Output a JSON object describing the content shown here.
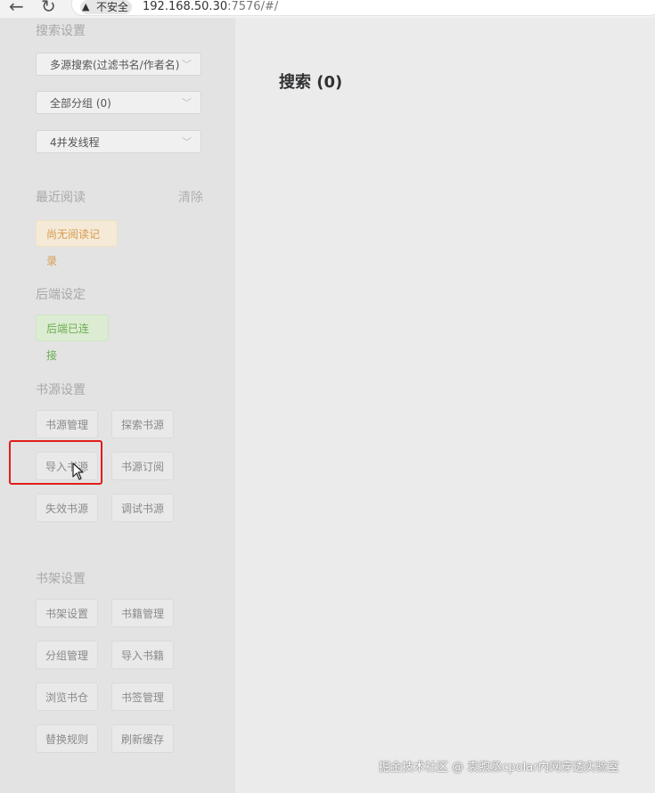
{
  "browser": {
    "security_label": "不安全",
    "url_host": "192.168.50.30",
    "url_rest": ":7576/#/"
  },
  "sidebar": {
    "search_settings": {
      "title": "搜索设置",
      "source_select": "多源搜索(过滤书名/作者名)",
      "group_select": "全部分组 (0)",
      "thread_select": "4并发线程"
    },
    "recent": {
      "title": "最近阅读",
      "clear_label": "清除",
      "empty_label": "尚无阅读记录"
    },
    "backend": {
      "title": "后端设定",
      "status_label": "后端已连接"
    },
    "source_settings": {
      "title": "书源设置",
      "buttons": [
        "书源管理",
        "探索书源",
        "导入书源",
        "书源订阅",
        "失效书源",
        "调试书源"
      ]
    },
    "shelf_settings": {
      "title": "书架设置",
      "buttons": [
        "书架设置",
        "书籍管理",
        "分组管理",
        "导入书籍",
        "浏览书仓",
        "书签管理",
        "替换规则",
        "刷新缓存"
      ]
    }
  },
  "main": {
    "title": "搜索 (0)"
  },
  "watermark": "掘金技术社区 @ 袁煦丞cpolar内网穿透实验室",
  "colors": {
    "highlight_box": "#e11d1d",
    "warning_badge": "#d79b4d",
    "success_badge": "#6bad52"
  }
}
